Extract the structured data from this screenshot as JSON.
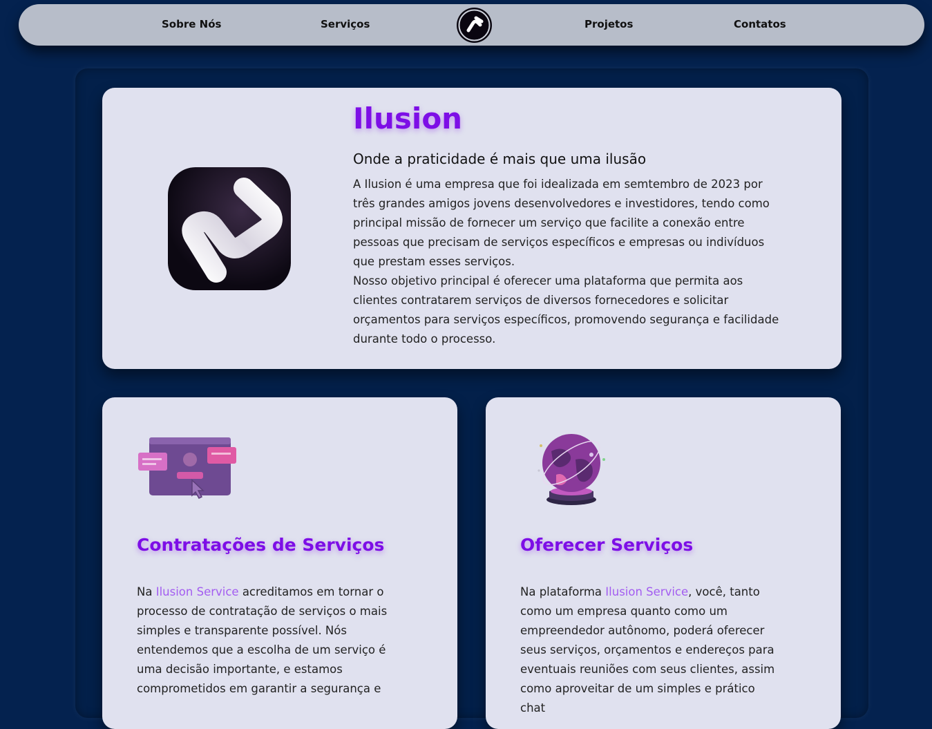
{
  "nav": {
    "items": [
      "Sobre Nós",
      "Serviços",
      "Projetos",
      "Contatos"
    ]
  },
  "hero": {
    "title": "Ilusion",
    "subtitle": "Onde a praticidade é mais que uma ilusão",
    "paragraph1": "A Ilusion é uma empresa que foi idealizada em semtembro de 2023 por três grandes amigos jovens desenvolvedores e investidores, tendo como principal missão de fornecer um serviço que facilite a conexão entre pessoas que precisam de serviços específicos e empresas ou indivíduos que prestam esses serviços.",
    "paragraph2": "Nosso objetivo principal é oferecer uma plataforma que permita aos clientes contratarem serviços de diversos fornecedores e solicitar orçamentos para serviços específicos, promovendo segurança e facilidade durante todo o processo."
  },
  "services": [
    {
      "icon": "browser-chat-cursor-icon",
      "title": "Contratações de Serviços",
      "text_before": "Na ",
      "brand": "Ilusion Service",
      "text_after": " acreditamos em tornar o processo de contratação de serviços o mais simples e transparente possível. Nós entendemos que a escolha de um serviço é uma decisão importante, e estamos comprometidos em garantir a segurança e"
    },
    {
      "icon": "globe-orbit-icon",
      "title": "Oferecer Serviços",
      "text_before": "Na plataforma ",
      "brand": "Ilusion Service",
      "text_after": ", você, tanto como um empresa quanto como um empreendedor autônomo, poderá oferecer seus serviços, orçamentos e endereços para eventuais reuniões com seus clientes, assim como aproveitar de um simples e prático chat"
    }
  ],
  "colors": {
    "background": "#04224f",
    "nav": "#b7bdc9",
    "card": "#e0e1ef",
    "accent": "#7d0ee6",
    "brand_link": "#a35df0"
  }
}
